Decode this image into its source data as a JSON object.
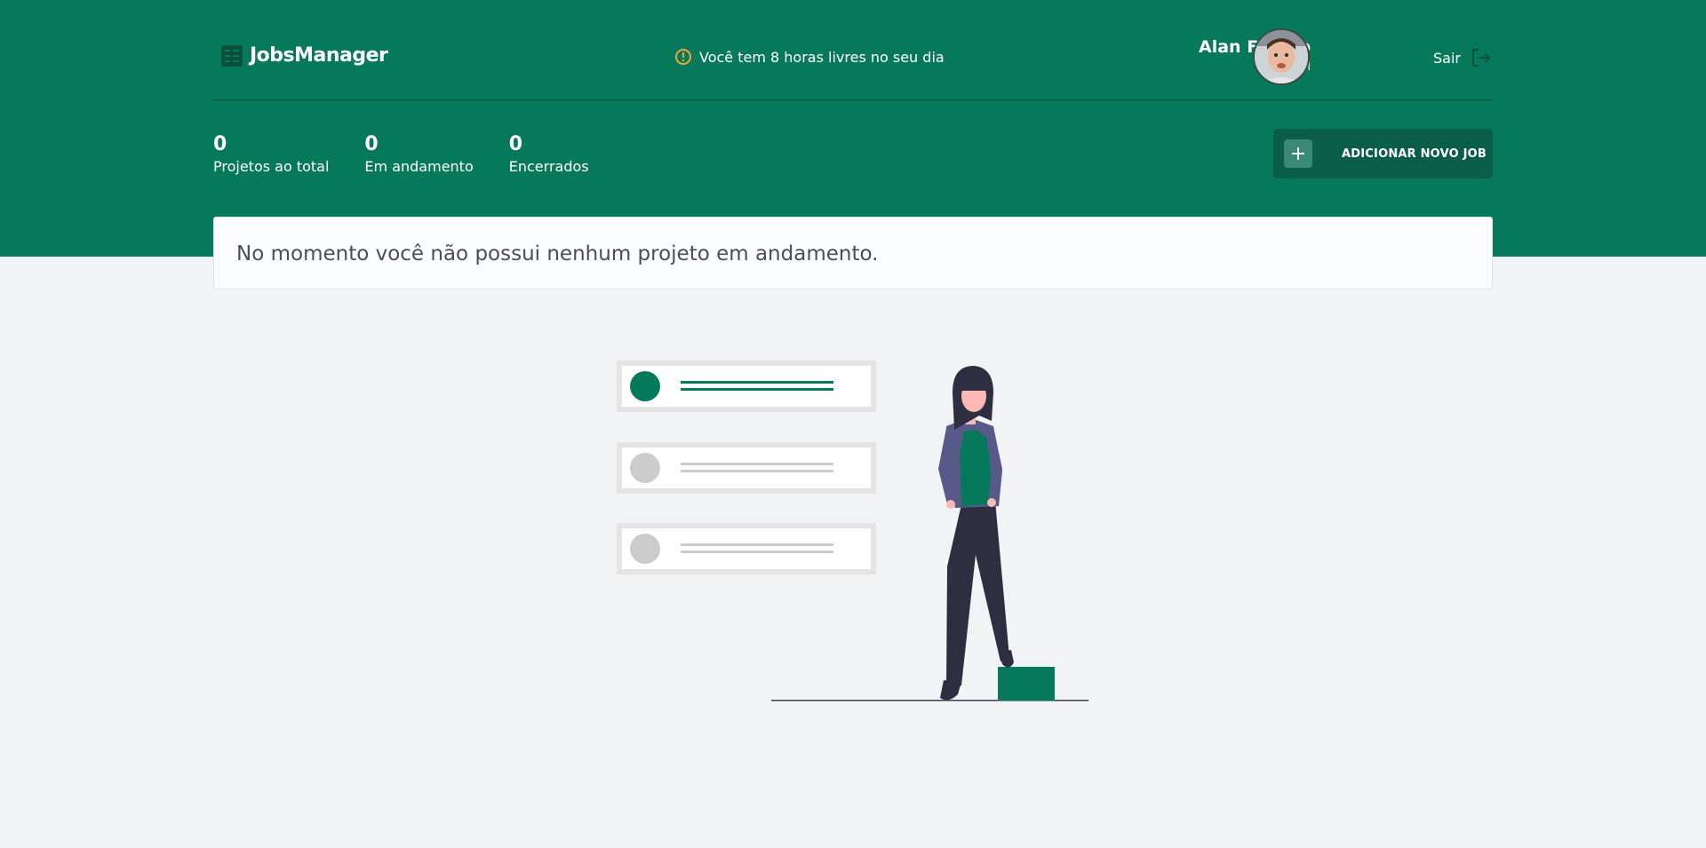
{
  "app": {
    "name": "JobsManager"
  },
  "alert": {
    "text": "Você tem 8 horas livres no seu dia",
    "icon": "alert-circle-icon",
    "icon_color": "#f2a632"
  },
  "profile": {
    "name": "Alan Franco",
    "link_label": "Ver perfil"
  },
  "logout": {
    "label": "Sair",
    "icon": "logout-icon"
  },
  "stats": [
    {
      "value": "0",
      "label": "Projetos ao total"
    },
    {
      "value": "0",
      "label": "Em andamento"
    },
    {
      "value": "0",
      "label": "Encerrados"
    }
  ],
  "add_job": {
    "label": "ADICIONAR NOVO JOB",
    "icon": "plus-icon"
  },
  "empty_state": {
    "message": "No momento você não possui nenhum projeto em andamento."
  },
  "colors": {
    "primary": "#05795a",
    "primary_dark": "#0a5e48",
    "background": "#f2f3f5",
    "card": "#fbfcfd",
    "text_muted": "#4b4e55"
  }
}
